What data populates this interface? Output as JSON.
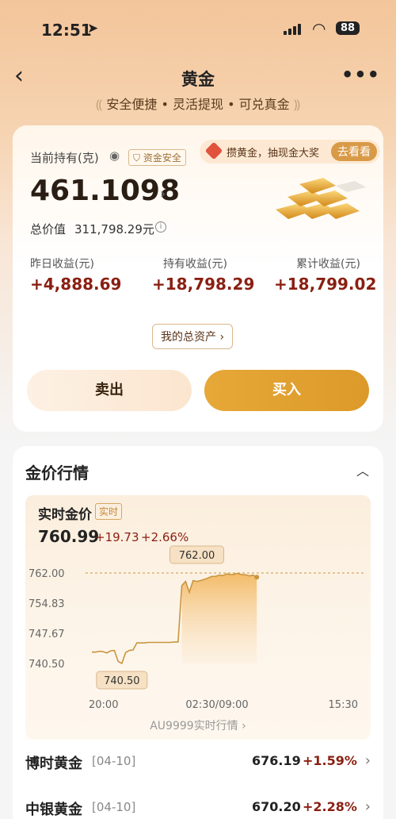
{
  "status": {
    "time": "12:51",
    "battery": "88"
  },
  "nav": {
    "title": "黄金",
    "back": "‹",
    "more": "•••"
  },
  "slogan": {
    "text": "安全便捷 • 灵活提现 • 可兑真金"
  },
  "holding": {
    "label": "当前持有(克)",
    "safe_badge": "资金安全",
    "promo_text": "攒黄金，抽现金大奖",
    "promo_button": "去看看",
    "amount": "461.1098",
    "total_label": "总价值",
    "total_value": "311,798.29元",
    "stats": [
      {
        "label": "昨日收益(元)",
        "value": "+4,888.69"
      },
      {
        "label": "持有收益(元)",
        "value": "+18,798.29"
      },
      {
        "label": "累计收益(元)",
        "value": "+18,799.02"
      }
    ],
    "assets_button": "我的总资产 ›",
    "sell_button": "卖出",
    "buy_button": "买入"
  },
  "market": {
    "title": "金价行情",
    "realtime_label": "实时金价",
    "realtime_badge": "实时",
    "price": "760.99",
    "change": "+19.73",
    "change_pct": "+2.66%",
    "feed_link": "AU9999实时行情 ›"
  },
  "chart_data": {
    "type": "line",
    "y_ticks": [
      "762.00",
      "754.83",
      "747.67",
      "740.50"
    ],
    "x_ticks": [
      "20:00",
      "02:30/09:00",
      "15:30"
    ],
    "ylim": [
      740.5,
      762.0
    ],
    "high_label": "762.00",
    "low_label": "740.50",
    "series": [
      {
        "values": [
          743.2,
          743.2,
          743.4,
          743.3,
          743.0,
          743.5,
          743.6,
          741.0,
          740.5,
          743.1,
          743.6,
          743.7,
          745.4,
          745.4,
          745.4,
          745.5,
          745.5,
          745.5,
          745.5,
          745.5,
          745.5,
          745.5,
          745.6,
          745.6,
          759.0,
          760.0,
          757.4,
          760.2,
          760.0,
          760.2,
          760.5,
          760.8,
          761.2,
          761.2,
          761.5,
          761.4,
          761.8,
          761.6,
          761.7,
          761.9,
          761.6,
          761.6,
          761.3,
          761.5,
          761.0
        ]
      }
    ]
  },
  "rows": [
    {
      "name": "博时黄金",
      "date": "[04-10]",
      "price": "676.19",
      "change": "+1.59%"
    },
    {
      "name": "中银黄金",
      "date": "[04-10]",
      "price": "670.20",
      "change": "+2.28%"
    }
  ],
  "colors": {
    "accent": "#dc9a2a",
    "up": "#8a1f12"
  }
}
